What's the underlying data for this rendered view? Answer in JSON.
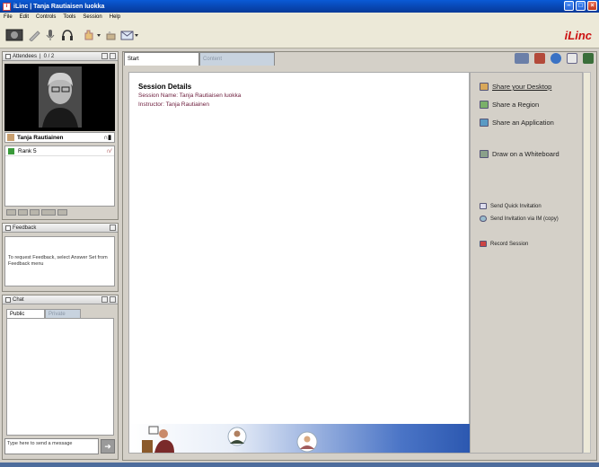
{
  "window": {
    "title": "iLinc | Tanja Rautiaisen luokka"
  },
  "menu": [
    "File",
    "Edit",
    "Controls",
    "Tools",
    "Session",
    "Help"
  ],
  "logo": {
    "text": "iLinc",
    "color": "#cc1111"
  },
  "attendees": {
    "header": "Attendees",
    "count": "0 / 2",
    "presenter_name": "Tanja Rautiainen",
    "rank_label": "Rank 5"
  },
  "feedback": {
    "header": "Feedback",
    "message": "To request Feedback, select Answer Set from Feedback menu"
  },
  "chat": {
    "header": "Chat",
    "tabs": [
      "Public",
      "Private"
    ],
    "input_placeholder": "Type here to send a message"
  },
  "main": {
    "tabs": [
      "Start",
      "Content"
    ],
    "session_title": "Session Details",
    "session_name": "Session Name: Tanja Rautiaisen luokka",
    "instructor": "Instructor: Tanja Rautiainen"
  },
  "actions": {
    "share_desktop": "Share your Desktop",
    "share_region": "Share a Region",
    "share_application": "Share an Application",
    "whiteboard": "Draw on a Whiteboard",
    "quick_invitation": "Send Quick Invitation",
    "im_invitation": "Send Invitation via IM (copy)",
    "record": "Record Session"
  },
  "colors": {
    "titlebar": "#0845b0",
    "session_text": "#6b1a3a",
    "panel_bg": "#d4d0c8"
  }
}
